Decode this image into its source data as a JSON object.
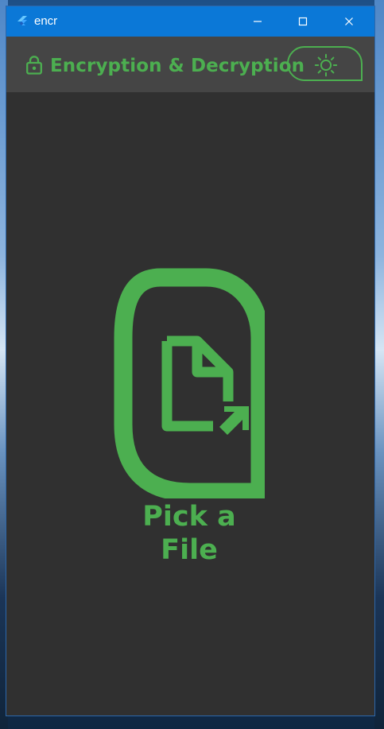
{
  "window": {
    "title": "encr"
  },
  "header": {
    "title": "Encryption & Decryption"
  },
  "actions": {
    "theme_toggle_icon": "sun-icon"
  },
  "main": {
    "picker_label": "Pick a File"
  },
  "colors": {
    "titlebar": "#0b78d7",
    "window_bg": "#303030",
    "header_bg": "#454545",
    "accent": "#4caf50",
    "titlebar_text": "#ffffff"
  },
  "icons": {
    "app_logo": "flutter-logo-icon",
    "minimize": "minimize-icon",
    "maximize": "maximize-icon",
    "close": "close-icon",
    "lock": "lock-icon",
    "theme": "sun-icon",
    "file_picker": "file-pick-icon"
  }
}
